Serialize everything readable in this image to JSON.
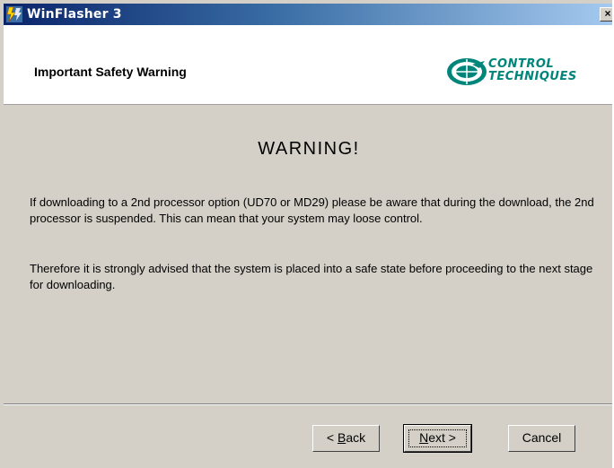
{
  "window": {
    "title": "WinFlasher 3",
    "close_symbol": "×"
  },
  "header": {
    "title": "Important Safety Warning",
    "logo_line1": "CONTROL",
    "logo_line2": "TECHNIQUES",
    "logo_icon": "control-techniques-logo"
  },
  "content": {
    "heading": "WARNING!",
    "paragraph1": "If downloading to a 2nd processor option (UD70 or MD29) please be aware that during the download, the 2nd processor is suspended. This can mean that your system may loose control.",
    "paragraph2": "Therefore it is strongly advised that the system is placed into a safe state before proceeding to the next stage for downloading."
  },
  "buttons": {
    "back_prefix": "< ",
    "back_hotkey": "B",
    "back_rest": "ack",
    "next_hotkey": "N",
    "next_rest": "ext >",
    "cancel": "Cancel"
  },
  "colors": {
    "title_gradient_start": "#0a246a",
    "title_gradient_end": "#a6caf0",
    "dialog_bg": "#d4d0c8",
    "logo_green": "#00857a"
  }
}
